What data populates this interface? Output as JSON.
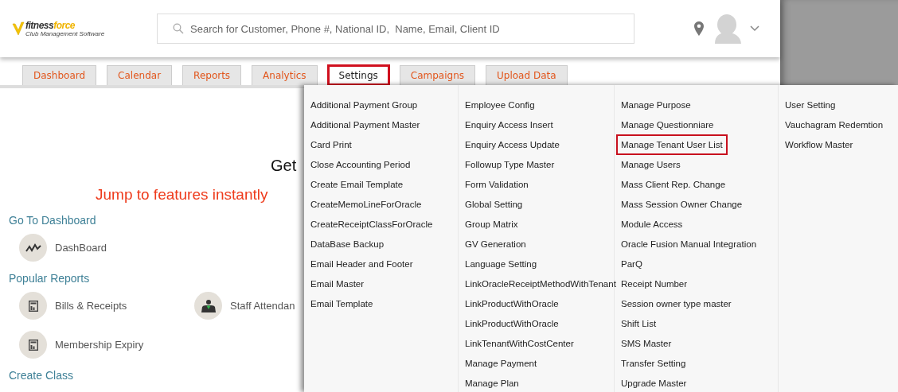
{
  "logo": {
    "name_a": "fitness",
    "name_b": "force",
    "tagline": "Club Management Software"
  },
  "search": {
    "placeholder": "Search for Customer, Phone #, National ID,  Name, Email, Client ID"
  },
  "tabs": [
    {
      "label": "Dashboard",
      "selected": false,
      "highlighted": false
    },
    {
      "label": "Calendar",
      "selected": false,
      "highlighted": false
    },
    {
      "label": "Reports",
      "selected": false,
      "highlighted": false
    },
    {
      "label": "Analytics",
      "selected": false,
      "highlighted": false
    },
    {
      "label": "Settings",
      "selected": true,
      "highlighted": true
    },
    {
      "label": "Campaigns",
      "selected": false,
      "highlighted": false
    },
    {
      "label": "Upload Data",
      "selected": false,
      "highlighted": false
    }
  ],
  "page": {
    "title": "Get",
    "subtitle": "Jump to features instantly",
    "sections": [
      {
        "heading": "Go To Dashboard",
        "items": [
          {
            "label": "DashBoard",
            "kind": "chart"
          }
        ]
      },
      {
        "heading": "Popular Reports",
        "items": [
          {
            "label": "Bills & Receipts",
            "kind": "report"
          },
          {
            "label": "Staff Attendan",
            "kind": "staff"
          },
          {
            "label": "Membership Expiry",
            "kind": "report"
          }
        ]
      },
      {
        "heading": "Create Class"
      }
    ]
  },
  "menu": {
    "columns": [
      [
        {
          "label": "Additional Payment Group",
          "highlighted": false
        },
        {
          "label": "Additional Payment Master",
          "highlighted": false
        },
        {
          "label": "Card Print",
          "highlighted": false
        },
        {
          "label": "Close Accounting Period",
          "highlighted": false
        },
        {
          "label": "Create Email Template",
          "highlighted": false
        },
        {
          "label": "CreateMemoLineForOracle",
          "highlighted": false
        },
        {
          "label": "CreateReceiptClassForOracle",
          "highlighted": false
        },
        {
          "label": "DataBase Backup",
          "highlighted": false
        },
        {
          "label": "Email Header and Footer",
          "highlighted": false
        },
        {
          "label": "Email Master",
          "highlighted": false
        },
        {
          "label": "Email Template",
          "highlighted": false
        }
      ],
      [
        {
          "label": "Employee Config",
          "highlighted": false
        },
        {
          "label": "Enquiry Access Insert",
          "highlighted": false
        },
        {
          "label": "Enquiry Access Update",
          "highlighted": false
        },
        {
          "label": "Followup Type Master",
          "highlighted": false
        },
        {
          "label": "Form Validation",
          "highlighted": false
        },
        {
          "label": "Global Setting",
          "highlighted": false
        },
        {
          "label": "Group Matrix",
          "highlighted": false
        },
        {
          "label": "GV Generation",
          "highlighted": false
        },
        {
          "label": "Language Setting",
          "highlighted": false
        },
        {
          "label": "LinkOracleReceiptMethodWithTenant",
          "highlighted": false
        },
        {
          "label": "LinkProductWithOracle",
          "highlighted": false
        },
        {
          "label": "LinkProductWithOracle",
          "highlighted": false
        },
        {
          "label": "LinkTenantWithCostCenter",
          "highlighted": false
        },
        {
          "label": "Manage Payment",
          "highlighted": false
        },
        {
          "label": "Manage Plan",
          "highlighted": false
        }
      ],
      [
        {
          "label": "Manage Purpose",
          "highlighted": false
        },
        {
          "label": "Manage Questionniare",
          "highlighted": false
        },
        {
          "label": "Manage Tenant User List",
          "highlighted": true
        },
        {
          "label": "Manage Users",
          "highlighted": false
        },
        {
          "label": "Mass Client Rep. Change",
          "highlighted": false
        },
        {
          "label": "Mass Session Owner Change",
          "highlighted": false
        },
        {
          "label": "Module Access",
          "highlighted": false
        },
        {
          "label": "Oracle Fusion Manual Integration",
          "highlighted": false
        },
        {
          "label": "ParQ",
          "highlighted": false
        },
        {
          "label": "Receipt Number",
          "highlighted": false
        },
        {
          "label": "Session owner type master",
          "highlighted": false
        },
        {
          "label": "Shift List",
          "highlighted": false
        },
        {
          "label": "SMS Master",
          "highlighted": false
        },
        {
          "label": "Transfer Setting",
          "highlighted": false
        },
        {
          "label": "Upgrade Master",
          "highlighted": false
        }
      ],
      [
        {
          "label": "User Setting",
          "highlighted": false
        },
        {
          "label": "Vauchagram Redemtion",
          "highlighted": false
        },
        {
          "label": "Workflow Master",
          "highlighted": false
        }
      ]
    ]
  }
}
